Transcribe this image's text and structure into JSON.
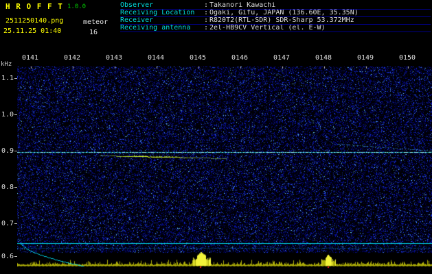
{
  "app": {
    "title": "H R O F F T",
    "version": "1.0.0",
    "filename": "2511250140.png",
    "mode_label": "meteor",
    "datetime": "25.11.25 01:40",
    "echo_count": "16"
  },
  "info": {
    "separator": ":",
    "rows": [
      {
        "label": "Observer",
        "value": "Takanori Kawachi"
      },
      {
        "label": "Receiving Location",
        "value": "Ogaki, Gifu, JAPAN (136.60E, 35.35N)"
      },
      {
        "label": "Receiver",
        "value": "R820T2(RTL-SDR) SDR-Sharp 53.372MHz"
      },
      {
        "label": "Receiving antenna",
        "value": "2el-HB9CV Vertical (el. E-W)"
      }
    ]
  },
  "chart_data": {
    "type": "heatmap",
    "description": "Radio meteor observation spectrogram (HROFFT), 10-minute window 01:41-01:50, blue noise background with yellow signal-activity strip at bottom",
    "ylabel": "kHz",
    "x_ticks": [
      "0141",
      "0142",
      "0143",
      "0144",
      "0145",
      "0146",
      "0147",
      "0148",
      "0149",
      "0150"
    ],
    "y_ticks": [
      "1.1",
      "1.0",
      "0.9",
      "0.8",
      "0.7",
      "0.6"
    ],
    "y_range_khz": [
      0.58,
      1.15
    ],
    "features": {
      "carrier_line_khz": 0.9,
      "meteor_trace": {
        "khz": 0.89,
        "from_time": "0142",
        "to_time": "0145",
        "color": "green-yellow"
      },
      "faint_drift_trace": {
        "from": {
          "time": "0148",
          "khz": 0.92
        },
        "to": {
          "time": "0150",
          "khz": 0.9
        }
      },
      "low_lines_khz": [
        0.63,
        0.62
      ],
      "descending_curve": {
        "from": {
          "time": "0141",
          "khz": 0.65
        },
        "to": {
          "time": "0142",
          "khz": 0.58
        }
      },
      "activity_strip": {
        "color": "yellow",
        "bursts_near": [
          "0145",
          "0148"
        ]
      }
    }
  }
}
